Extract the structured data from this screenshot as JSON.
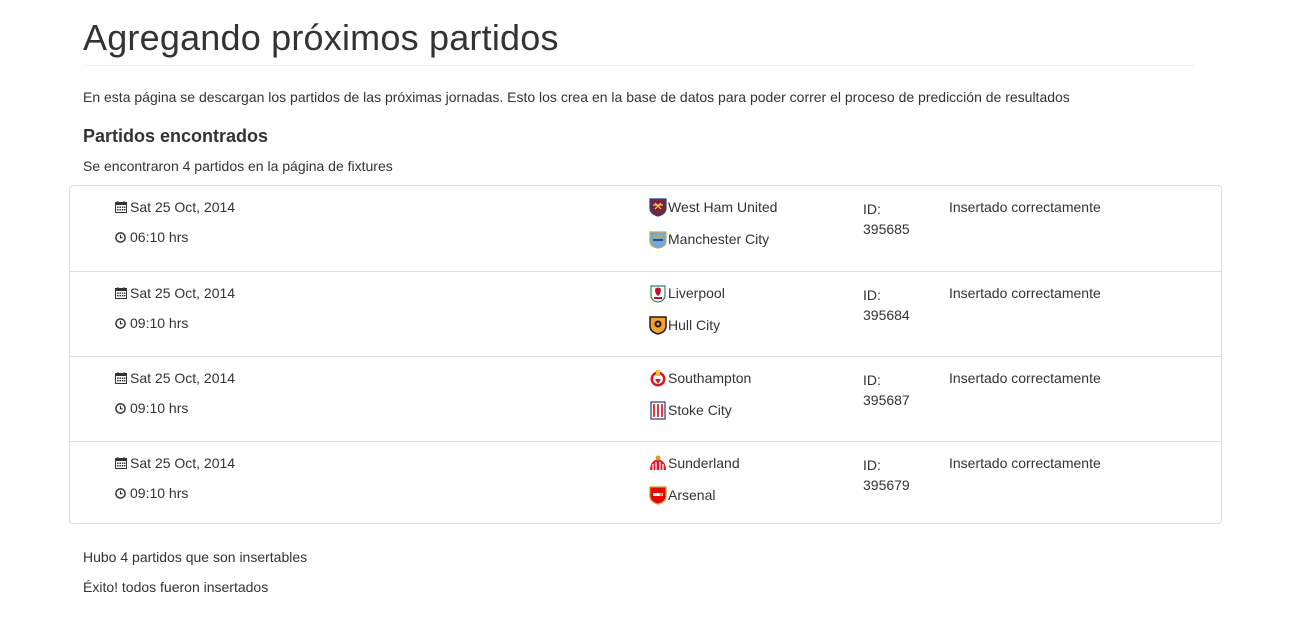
{
  "page": {
    "title": "Agregando próximos partidos",
    "intro": "En esta página se descargan los partidos de las próximas jornadas. Esto los crea en la base de datos para poder correr el proceso de predicción de resultados",
    "section_title": "Partidos encontrados",
    "found_text": "Se encontraron 4 partidos en la página de fixtures"
  },
  "matches": [
    {
      "date": "Sat 25 Oct, 2014",
      "time": "06:10 hrs",
      "home": "West Ham United",
      "away": "Manchester City",
      "id_label": "ID:",
      "id": "395685",
      "status": "Insertado correctamente",
      "home_color": "#7a263a",
      "away_color": "#6cabdd"
    },
    {
      "date": "Sat 25 Oct, 2014",
      "time": "09:10 hrs",
      "home": "Liverpool",
      "away": "Hull City",
      "id_label": "ID:",
      "id": "395684",
      "status": "Insertado correctamente",
      "home_color": "#c8102e",
      "away_color": "#f5a12d"
    },
    {
      "date": "Sat 25 Oct, 2014",
      "time": "09:10 hrs",
      "home": "Southampton",
      "away": "Stoke City",
      "id_label": "ID:",
      "id": "395687",
      "status": "Insertado correctamente",
      "home_color": "#d71920",
      "away_color": "#e03a3e"
    },
    {
      "date": "Sat 25 Oct, 2014",
      "time": "09:10 hrs",
      "home": "Sunderland",
      "away": "Arsenal",
      "id_label": "ID:",
      "id": "395679",
      "status": "Insertado correctamente",
      "home_color": "#eb172b",
      "away_color": "#ef0107"
    }
  ],
  "footer": {
    "insertable_text": "Hubo 4 partidos que son insertables",
    "success_text": "Éxito! todos fueron insertados"
  },
  "icons": {
    "date": "calendar-icon",
    "time": "clock-icon",
    "crest": "team-crest-icon"
  }
}
